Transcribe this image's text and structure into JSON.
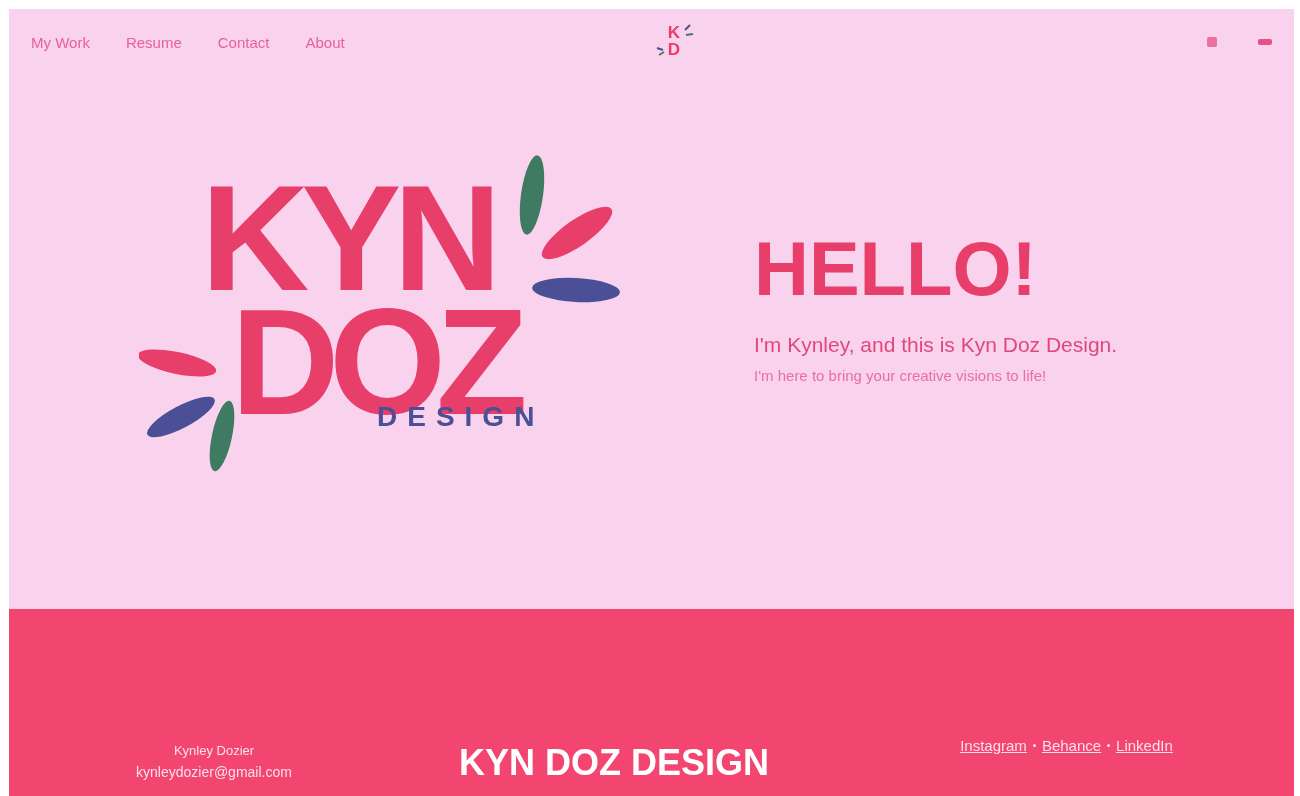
{
  "nav": {
    "links": [
      "My Work",
      "Resume",
      "Contact",
      "About"
    ],
    "logo": {
      "top": "K",
      "bottom": "D"
    }
  },
  "hero": {
    "logo": {
      "line_1": "KYN",
      "line_2": "DOZ",
      "line_3": "DESIGN"
    },
    "heading": "HELLO!",
    "intro": "I'm Kynley, and this is Kyn Doz Design.",
    "tagline": "I'm here to bring your creative visions to life!"
  },
  "footer": {
    "name": "Kynley Dozier",
    "email": "kynleydozier@gmail.com",
    "title": "KYN DOZ DESIGN",
    "links": [
      "Instagram",
      "Behance",
      "LinkedIn"
    ]
  }
}
